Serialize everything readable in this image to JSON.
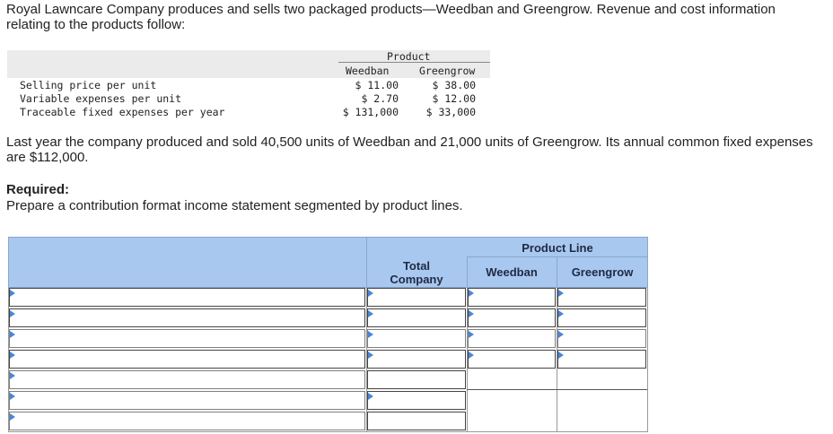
{
  "intro": "Royal Lawncare Company produces and sells two packaged products—Weedban and Greengrow. Revenue and cost information relating to the products follow:",
  "info_table": {
    "header_group": "Product",
    "columns": [
      "Weedban",
      "Greengrow"
    ],
    "rows": [
      {
        "label": "Selling price per unit",
        "weedban": "$ 11.00",
        "greengrow": "$ 38.00"
      },
      {
        "label": "Variable expenses per unit",
        "weedban": "$ 2.70",
        "greengrow": "$ 12.00"
      },
      {
        "label": "Traceable fixed expenses per year",
        "weedban": "$ 131,000",
        "greengrow": "$ 33,000"
      }
    ]
  },
  "last_year": "Last year the company produced and sold 40,500 units of Weedban and 21,000 units of Greengrow. Its annual common fixed expenses are $112,000.",
  "required_heading": "Required:",
  "required_text": "Prepare a contribution format income statement segmented by product lines.",
  "answer_table": {
    "group_header": "Product Line",
    "col_total": "Total Company",
    "col_weedban": "Weedban",
    "col_greengrow": "Greengrow",
    "row_count": 7
  },
  "colors": {
    "header_blue": "#a8c8ef",
    "dropdown_arrow": "#4a86d8"
  }
}
